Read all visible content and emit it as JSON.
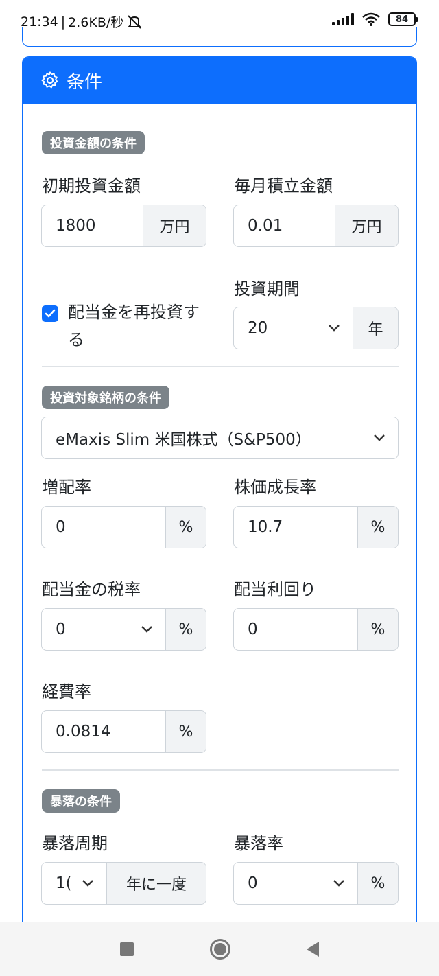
{
  "status_bar": {
    "time": "21:34",
    "network_speed": "2.6KB/秒",
    "battery": "84"
  },
  "card": {
    "title": "条件",
    "header_icon": "gear-icon",
    "accent_color": "#0d6efd"
  },
  "investment_amount": {
    "section_title": "投資金額の条件",
    "initial_label": "初期投資金額",
    "initial_value": "1800",
    "initial_unit": "万円",
    "monthly_label": "毎月積立金額",
    "monthly_value": "0.01",
    "monthly_unit": "万円",
    "reinvest_label": "配当金を再投資する",
    "reinvest_checked": true,
    "period_label": "投資期間",
    "period_value": "20",
    "period_unit": "年"
  },
  "target_fund": {
    "section_title": "投資対象銘柄の条件",
    "fund_selected": "eMaxis Slim 米国株式（S&P500）",
    "dividend_growth_label": "増配率",
    "dividend_growth_value": "0",
    "dividend_growth_unit": "%",
    "price_growth_label": "株価成長率",
    "price_growth_value": "10.7",
    "price_growth_unit": "%",
    "tax_label": "配当金の税率",
    "tax_value": "0",
    "tax_unit": "%",
    "yield_label": "配当利回り",
    "yield_value": "0",
    "yield_unit": "%",
    "expense_label": "経費率",
    "expense_value": "0.0814",
    "expense_unit": "%"
  },
  "crash": {
    "section_title": "暴落の条件",
    "cycle_label": "暴落周期",
    "cycle_value": "1(",
    "cycle_unit": "年に一度",
    "rate_label": "暴落率",
    "rate_value": "0",
    "rate_unit": "%"
  }
}
